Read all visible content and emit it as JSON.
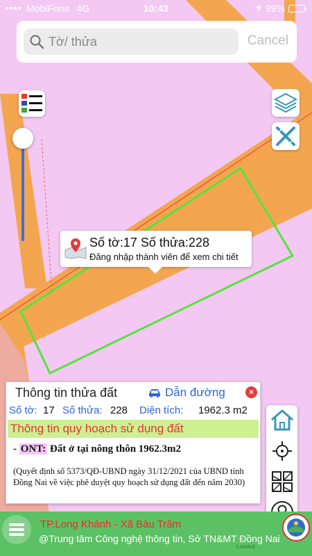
{
  "status_bar": {
    "carrier": "MobiFone",
    "network": "4G",
    "time": "10:43",
    "battery": "99%",
    "battery_level": 0.99
  },
  "search": {
    "placeholder": "Tờ/ thửa",
    "cancel_label": "Cancel"
  },
  "callout": {
    "title": "Số tờ:17 Số thửa:228",
    "subtitle": "Đăng nhập thành viên để xem chi tiết"
  },
  "info_panel": {
    "title": "Thông tin thửa đất",
    "directions_label": "Dẫn đường",
    "close_label": "×",
    "sheet_label": "Số tờ:",
    "sheet_value": "17",
    "parcel_label": "Số thửa:",
    "parcel_value": "228",
    "area_label": "Diện tích:",
    "area_value": "1962.3 m2",
    "plan_heading": "Thông tin quy hoạch sử dụng đất",
    "land_prefix": "- ",
    "land_code": "ONT:",
    "land_desc": "Đất ở tại nông thôn 1962.3m2",
    "decision_text": "(Quyết định số 5373/QĐ-UBND ngày 31/12/2021 của UBND tỉnh Đồng Nai về việc phê duyệt quy hoạch sử dụng đất đến năm 2030)"
  },
  "bottom_bar": {
    "location": "TP.Long Khánh - Xã Bàu Trâm",
    "credit": "@Trung tâm Công nghệ thông tin, Sở TN&MT Đồng Nai",
    "loaded": "Loaded"
  },
  "colors": {
    "map_background": "#f3c8f3",
    "road": "#f3a64f",
    "parcel_border": "#57e23e",
    "accent_blue": "#2c66d6",
    "plan_bar": "#cdf092",
    "plan_text": "#e23636",
    "bottom_bar": "#5cc165"
  }
}
